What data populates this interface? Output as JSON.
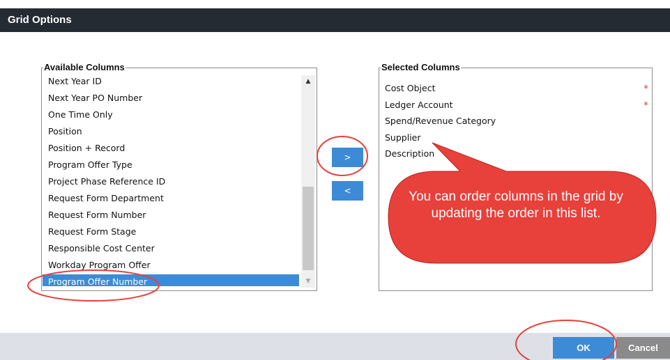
{
  "dialog": {
    "title": "Grid Options"
  },
  "available_columns": {
    "legend": "Available Columns",
    "items": [
      "Next Year ID",
      "Next Year PO Number",
      "One Time Only",
      "Position",
      "Position + Record",
      "Program Offer Type",
      "Project Phase Reference ID",
      "Request Form Department",
      "Request Form Number",
      "Request Form Stage",
      "Responsible Cost Center",
      "Workday Program Offer",
      "Program Offer Number"
    ],
    "selected_item": "Program Offer Number"
  },
  "selected_columns": {
    "legend": "Selected Columns",
    "items": [
      {
        "label": "Cost Object",
        "required_marker": "*"
      },
      {
        "label": "Ledger Account",
        "required_marker": "*"
      },
      {
        "label": "Spend/Revenue Category"
      },
      {
        "label": "Supplier"
      },
      {
        "label": "Description"
      }
    ]
  },
  "move_buttons": {
    "add_label": ">",
    "remove_label": "<"
  },
  "footer": {
    "ok_label": "OK",
    "cancel_label": "Cancel"
  },
  "annotation": {
    "callout_text": "You can order columns in the grid by updating the order in this list.",
    "color": "#e8403a"
  },
  "colors": {
    "title_bar": "#242b33",
    "accent": "#3d8bd6",
    "footer": "#dde1e7",
    "cancel": "#8a8a8a"
  }
}
